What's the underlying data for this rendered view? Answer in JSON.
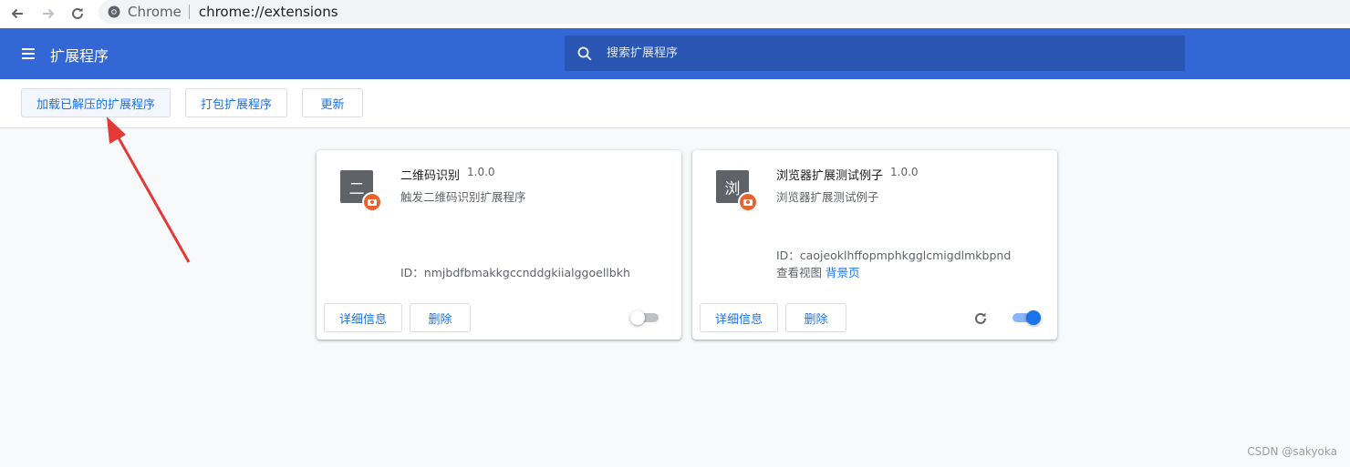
{
  "browser": {
    "host": "Chrome",
    "url": "chrome://extensions"
  },
  "header": {
    "title": "扩展程序",
    "search_placeholder": "搜索扩展程序"
  },
  "toolbar": {
    "load_unpacked": "加载已解压的扩展程序",
    "pack": "打包扩展程序",
    "update": "更新"
  },
  "extensions": [
    {
      "icon_letter": "二",
      "name": "二维码识别",
      "version": "1.0.0",
      "description": "触发二维码识别扩展程序",
      "id_text": "ID：nmjbdfbmakkgccnddgkiialggoellbkh",
      "details_label": "详细信息",
      "remove_label": "删除",
      "enabled": false
    },
    {
      "icon_letter": "浏",
      "name": "浏览器扩展测试例子",
      "version": "1.0.0",
      "description": "浏览器扩展测试例子",
      "id_text": "ID：caojeoklhffopmphkgglcmigdlmkbpnd",
      "views_label": "查看视图",
      "views_link": "背景页",
      "details_label": "详细信息",
      "remove_label": "删除",
      "enabled": true
    }
  ],
  "watermark": "CSDN @sakyoka",
  "colors": {
    "header": "#3367d6",
    "accent": "#1a73e8",
    "arrow": "#e53935"
  }
}
